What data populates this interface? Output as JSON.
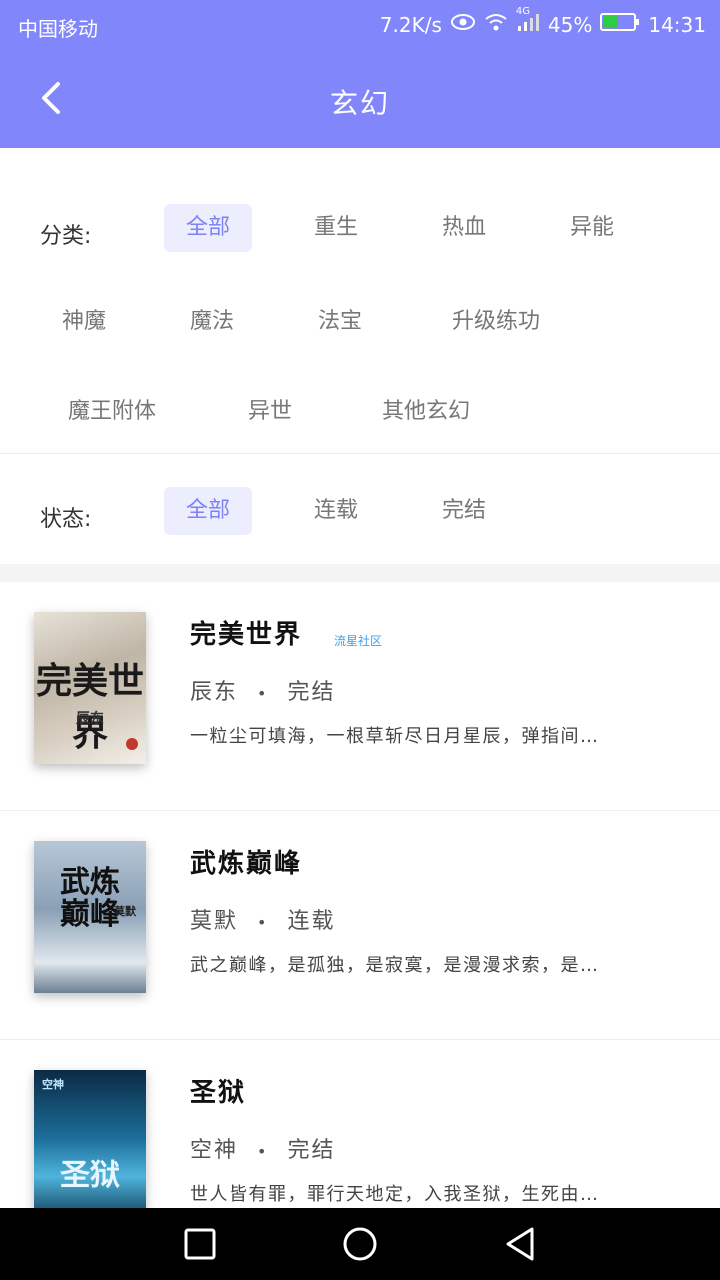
{
  "status_bar": {
    "carrier": "中国移动",
    "speed": "7.2K/s",
    "network": "4G",
    "battery": "45%",
    "time": "14:31",
    "icons": [
      "eye-icon",
      "wifi-icon",
      "signal-icon",
      "battery-icon"
    ]
  },
  "header": {
    "title": "玄幻",
    "back_icon": "chevron-left-icon"
  },
  "filters": {
    "category_label": "分类:",
    "categories": [
      "全部",
      "重生",
      "热血",
      "异能",
      "神魔",
      "魔法",
      "法宝",
      "升级练功",
      "魔王附体",
      "异世",
      "其他玄幻"
    ],
    "category_selected": "全部",
    "status_label": "状态:",
    "statuses": [
      "全部",
      "连载",
      "完结"
    ],
    "status_selected": "全部"
  },
  "books": [
    {
      "title": "完美世界",
      "badge": "流星社区",
      "author": "辰东",
      "separator": "•",
      "status": "完结",
      "description": "一粒尘可填海，一根草斩尽日月星辰，弹指间…",
      "cover_text": "完美世界",
      "cover_sub": "辰东"
    },
    {
      "title": "武炼巅峰",
      "author": "莫默",
      "separator": "•",
      "status": "连载",
      "description": "武之巅峰，是孤独，是寂寞，是漫漫求索，是…",
      "cover_text": "武炼巅峰",
      "cover_sub": "莫默"
    },
    {
      "title": "圣狱",
      "author": "空神",
      "separator": "•",
      "status": "完结",
      "description": "世人皆有罪，罪行天地定，入我圣狱，生死由…",
      "cover_text": "圣狱",
      "cover_sub": "空神"
    }
  ],
  "nav_bar": {
    "icons": [
      "recent-apps-icon",
      "home-icon",
      "back-triangle-icon"
    ]
  },
  "colors": {
    "primary": "#8286fb",
    "chip_active_bg": "#eceefe",
    "chip_active_text": "#7d82f5",
    "badge": "#3aa1ec"
  }
}
